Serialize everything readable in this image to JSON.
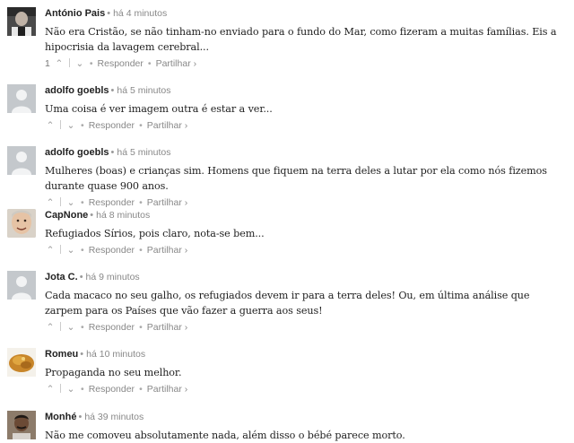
{
  "comments": [
    {
      "author": "António Pais",
      "time": "há 4 minutos",
      "avatar": "photo-dark",
      "text": "Não era Cristão, se não tinham-no enviado para o fundo do Mar, como fizeram a muitas famílias. Eis a hipocrisia da lavagem cerebral...",
      "votes": "1",
      "reply": "Responder",
      "share": "Partilhar ›"
    },
    {
      "author": "adolfo goebls",
      "time": "há 5 minutos",
      "avatar": "default-user",
      "text": "Uma coisa é ver imagem outra é estar a ver...",
      "votes": "",
      "reply": "Responder",
      "share": "Partilhar ›"
    },
    {
      "author": "adolfo goebls",
      "time": "há 5 minutos",
      "avatar": "default-user",
      "text": "Mulheres (boas) e crianças sim. Homens que fiquem na terra deles a lutar por ela como nós fizemos durante quase 900 anos.",
      "votes": "",
      "reply": "Responder",
      "share": "Partilhar ›"
    },
    {
      "author": "CapNone",
      "time": "há 8 minutos",
      "avatar": "photo-face",
      "text": "Refugiados Sírios, pois claro, nota-se bem...",
      "votes": "",
      "reply": "Responder",
      "share": "Partilhar ›"
    },
    {
      "author": "Jota C.",
      "time": "há 9 minutos",
      "avatar": "default-user",
      "text": "Cada macaco no seu galho, os refugiados devem ir para a terra deles! Ou, em última análise que zarpem para os Países que vão fazer a guerra aos seus!",
      "votes": "",
      "reply": "Responder",
      "share": "Partilhar ›"
    },
    {
      "author": "Romeu",
      "time": "há 10 minutos",
      "avatar": "photo-food",
      "text": "Propaganda no seu melhor.",
      "votes": "",
      "reply": "Responder",
      "share": "Partilhar ›"
    },
    {
      "author": "Monhé",
      "time": "há 39 minutos",
      "avatar": "photo-man",
      "text": "Não me comoveu absolutamente nada, além disso o bébé parece morto.",
      "votes": "",
      "reply": "Responder",
      "share": "Partilhar ›"
    }
  ],
  "colors": {
    "default_avatar_bg": "#c4c8cc",
    "meta": "#888888"
  }
}
